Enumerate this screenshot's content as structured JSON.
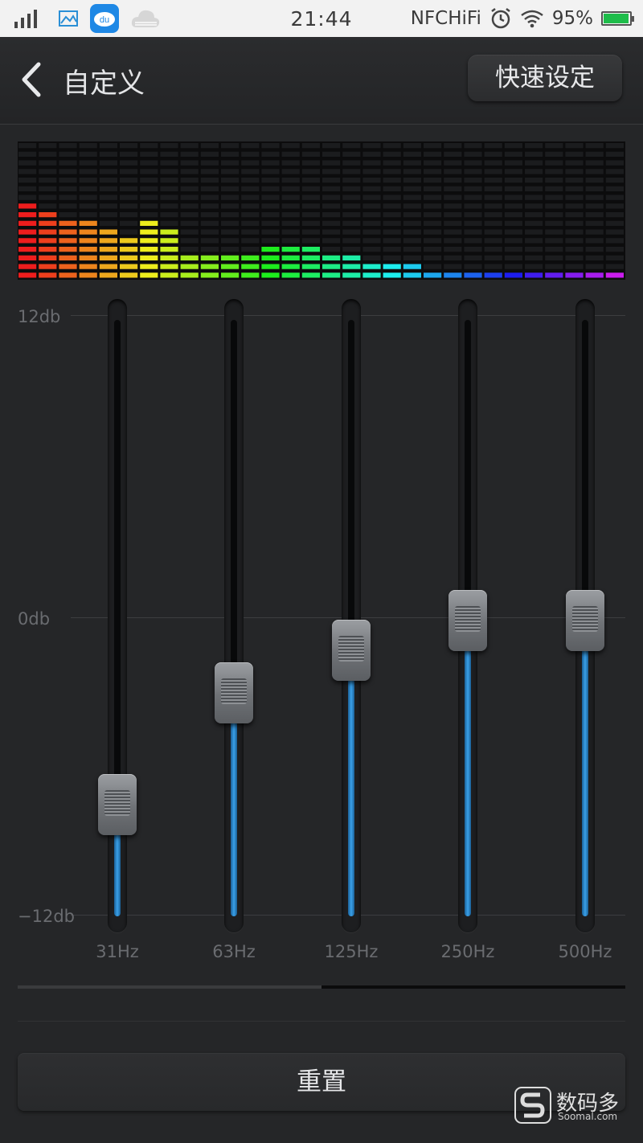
{
  "status_bar": {
    "time": "21:44",
    "nfc": "NFC",
    "hifi": "HiFi",
    "battery_percent": "95%",
    "icons": [
      "signal-icon",
      "gallery-icon",
      "baidu-cloud-icon",
      "cloud-icon",
      "alarm-icon",
      "wifi-icon",
      "battery-icon"
    ],
    "battery_color": "#1ebd4a"
  },
  "header": {
    "back_icon": "chevron-left-icon",
    "title": "自定义",
    "preset_button": "快速设定"
  },
  "equalizer": {
    "db_labels": {
      "max": "12db",
      "zero": "0db",
      "min": "−12db"
    },
    "range_db": [
      -12,
      12
    ],
    "bands": [
      {
        "label": "31Hz",
        "gain_db": -7.5
      },
      {
        "label": "63Hz",
        "gain_db": -3.0
      },
      {
        "label": "125Hz",
        "gain_db": -1.3
      },
      {
        "label": "250Hz",
        "gain_db": -0.1
      },
      {
        "label": "500Hz",
        "gain_db": -0.1
      }
    ],
    "accent_color": "#3aa0e8"
  },
  "spectrum": {
    "columns": 30,
    "levels": [
      9,
      8,
      7,
      7,
      6,
      5,
      7,
      6,
      3,
      3,
      3,
      3,
      4,
      4,
      4,
      3,
      3,
      2,
      2,
      2,
      1,
      1,
      1,
      1,
      1,
      1,
      1,
      1,
      1,
      1
    ]
  },
  "scroll": {
    "position_fraction": 1.0,
    "pages": 2
  },
  "reset_button": "重置",
  "watermark": {
    "text": "数码多",
    "sub": "Soomal.com"
  }
}
